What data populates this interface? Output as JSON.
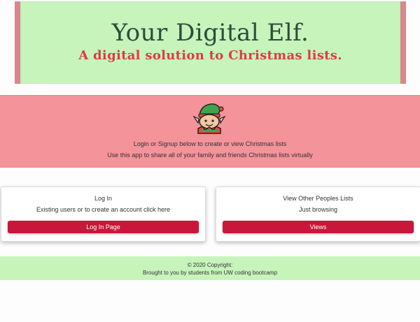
{
  "header": {
    "title": "Your Digital Elf.",
    "subtitle": "A digital solution to Christmas lists."
  },
  "banner": {
    "icon": "elf-icon",
    "line1": "Login or Signup below to create or view Christmas lists",
    "line2": "Use this app to share all of your family and friends Christmas lists virtually"
  },
  "cards": [
    {
      "title": "Log In",
      "text": "Existing users or to create an account click here",
      "button": "Log In Page"
    },
    {
      "title": "View Other Peoples Lists",
      "text": "Just browsing",
      "button": "Views"
    }
  ],
  "footer": {
    "copyright": "© 2020 Copyright:",
    "credit": "Brought to you by students from UW coding bootcamp"
  },
  "colors": {
    "header_bg": "#c6f4bb",
    "header_border": "#d8878d",
    "banner_bg": "#f4939a",
    "button_bg": "#c8173a",
    "title": "#2f4a3a",
    "subtitle": "#de3b45"
  }
}
